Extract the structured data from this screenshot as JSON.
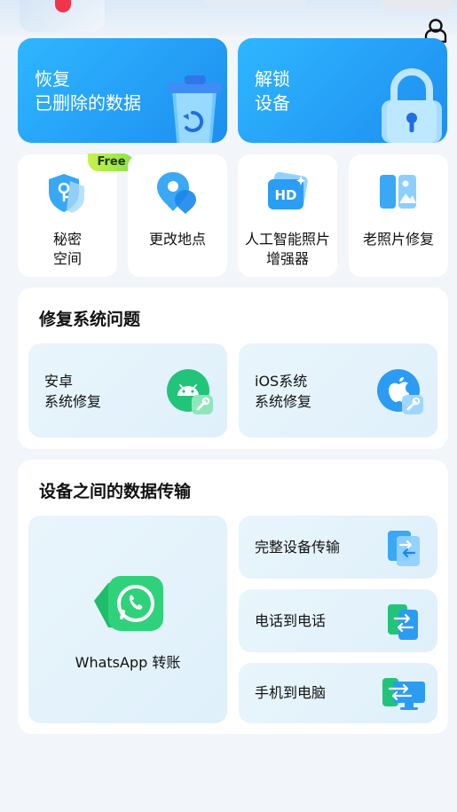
{
  "hero": {
    "recover": {
      "line1": "恢复",
      "line2": "已删除的数据"
    },
    "unlock": {
      "line1": "解锁",
      "line2": "设备"
    }
  },
  "tools": [
    {
      "line1": "秘密",
      "line2": "空间",
      "badge": "Free",
      "icon": "secret-space-icon"
    },
    {
      "line1": "更改地点",
      "line2": "",
      "icon": "location-icon"
    },
    {
      "line1": "人工智能照片",
      "line2": "增强器",
      "icon": "hd-photo-icon"
    },
    {
      "line1": "老照片修复",
      "line2": "",
      "icon": "old-photo-icon"
    }
  ],
  "system_repair": {
    "title": "修复系统问题",
    "android": {
      "line1": "安卓",
      "line2": "系统修复",
      "icon": "android-repair-icon"
    },
    "ios": {
      "line1": "iOS系统",
      "line2": "系统修复",
      "icon": "ios-repair-icon"
    }
  },
  "transfer": {
    "title": "设备之间的数据传输",
    "whatsapp": {
      "label": "WhatsApp 转账",
      "icon": "whatsapp-icon"
    },
    "items": [
      {
        "label": "完整设备传输",
        "icon": "device-transfer-icon"
      },
      {
        "label": "电话到电话",
        "icon": "phone-to-phone-icon"
      },
      {
        "label": "手机到电脑",
        "icon": "phone-to-pc-icon"
      }
    ]
  },
  "colors": {
    "accent": "#1d8ef0",
    "hero_light": "#2fb6ff",
    "green": "#22c47a",
    "badge": "#b5ec4a"
  }
}
